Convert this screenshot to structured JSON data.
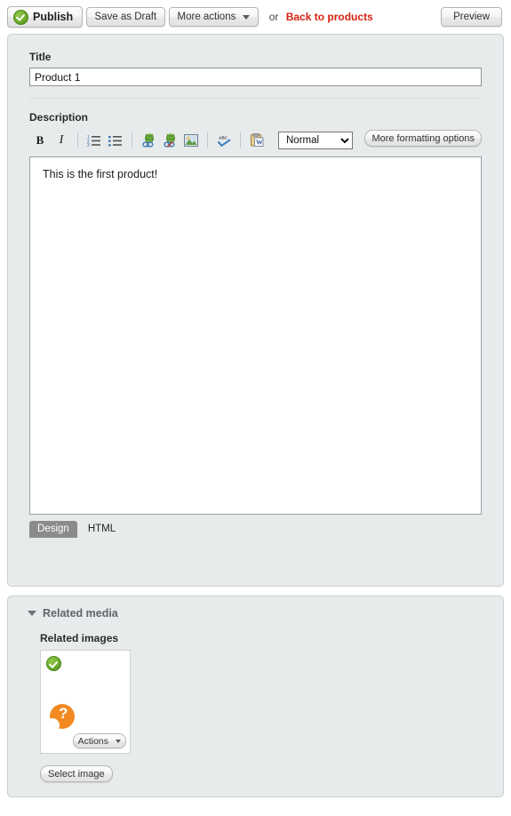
{
  "actionbar": {
    "publish_label": "Publish",
    "publish_icon": "green-check-circle-icon",
    "save_draft_label": "Save as Draft",
    "more_actions_label": "More actions",
    "or_label": "or",
    "back_link_label": "Back to products",
    "back_link_color": "#d62211",
    "preview_label": "Preview"
  },
  "form": {
    "title_label": "Title",
    "title_value": "Product 1",
    "title_placeholder": "",
    "description_label": "Description"
  },
  "editor": {
    "toolbar": [
      {
        "name": "bold-icon",
        "glyph": "B",
        "title": "Bold"
      },
      {
        "name": "italic-icon",
        "glyph": "I",
        "title": "Italic"
      },
      {
        "name": "ordered-list-icon",
        "glyph": "",
        "title": "Numbered list"
      },
      {
        "name": "unordered-list-icon",
        "glyph": "",
        "title": "Bulleted list"
      },
      {
        "name": "insert-link-icon",
        "glyph": "",
        "title": "Insert link"
      },
      {
        "name": "remove-link-icon",
        "glyph": "",
        "title": "Remove link"
      },
      {
        "name": "insert-image-icon",
        "glyph": "",
        "title": "Insert image"
      },
      {
        "name": "spellcheck-icon",
        "glyph": "",
        "title": "Check spelling"
      },
      {
        "name": "paste-from-word-icon",
        "glyph": "",
        "title": "Paste from Word"
      }
    ],
    "format_selected": "Normal",
    "format_options": [
      "Normal"
    ],
    "more_formatting_label": "More formatting options",
    "content_text": "This is the first product!",
    "tabs": [
      {
        "label": "Design",
        "active": true
      },
      {
        "label": "HTML",
        "active": false
      }
    ]
  },
  "related_media": {
    "section_title": "Related media",
    "images_label": "Related images",
    "thumbnail": {
      "status_icon": "green-check-circle-icon",
      "placeholder_icon": "broken-image-icon",
      "placeholder_color": "#f28a21",
      "actions_label": "Actions"
    },
    "select_image_label": "Select image"
  }
}
